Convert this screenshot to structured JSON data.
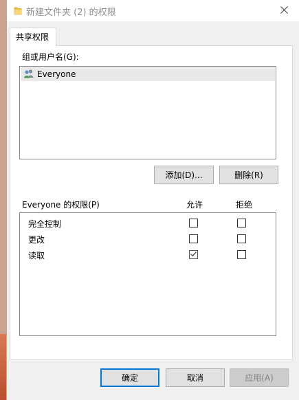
{
  "window": {
    "title": "新建文件夹 (2) 的权限",
    "icons": {
      "title": "folder-icon",
      "close": "close-icon"
    }
  },
  "tabs": [
    {
      "label": "共享权限",
      "selected": true
    }
  ],
  "users": {
    "label": "组或用户名(G):",
    "items": [
      {
        "name": "Everyone",
        "icon": "users-icon",
        "selected": true
      }
    ]
  },
  "user_buttons": {
    "add": "添加(D)...",
    "remove": "删除(R)"
  },
  "permissions": {
    "label": "Everyone 的权限(P)",
    "allow_header": "允许",
    "deny_header": "拒绝",
    "rows": [
      {
        "name": "完全控制",
        "allow": false,
        "deny": false
      },
      {
        "name": "更改",
        "allow": false,
        "deny": false
      },
      {
        "name": "读取",
        "allow": true,
        "deny": false
      }
    ]
  },
  "footer": {
    "ok": "确定",
    "cancel": "取消",
    "apply": "应用(A)"
  }
}
